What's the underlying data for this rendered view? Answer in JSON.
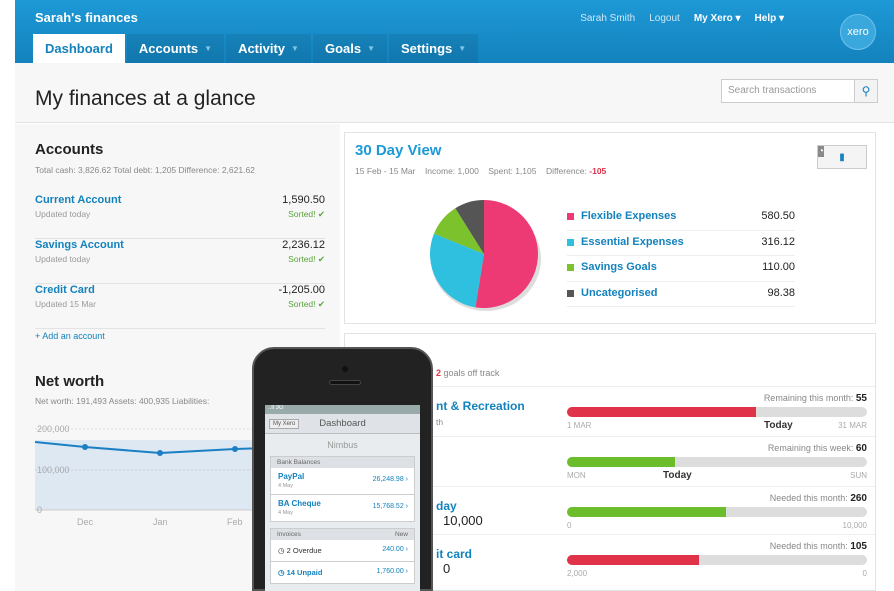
{
  "app": {
    "title": "Sarah's finances",
    "logo": "xero"
  },
  "toplinks": {
    "user": "Sarah Smith",
    "logout": "Logout",
    "myxero": "My Xero ▾",
    "help": "Help ▾"
  },
  "tabs": [
    {
      "label": "Dashboard",
      "active": true
    },
    {
      "label": "Accounts"
    },
    {
      "label": "Activity"
    },
    {
      "label": "Goals"
    },
    {
      "label": "Settings"
    }
  ],
  "page": {
    "title": "My finances at a glance",
    "search_placeholder": "Search transactions"
  },
  "accounts": {
    "title": "Accounts",
    "summary": "Total cash: 3,826.62   Total debt: 1,205   Difference: 2,621.62",
    "items": [
      {
        "name": "Current Account",
        "updated": "Updated today",
        "amount": "1,590.50",
        "status": "Sorted! ✔"
      },
      {
        "name": "Savings Account",
        "updated": "Updated today",
        "amount": "2,236.12",
        "status": "Sorted! ✔"
      },
      {
        "name": "Credit Card",
        "updated": "Updated 15 Mar",
        "amount": "-1,205.00",
        "status": "Sorted! ✔"
      }
    ],
    "add": "+ Add an account"
  },
  "networth": {
    "title": "Net worth",
    "summary": "Net worth: 191,493   Assets: 400,935   Liabilities:",
    "ticks_y": [
      "200,000",
      "100,000",
      "0"
    ],
    "ticks_x": [
      "Dec",
      "Jan",
      "Feb"
    ]
  },
  "thirty": {
    "title": "30 Day View",
    "range": "15 Feb - 15 Mar",
    "income": "Income: 1,000",
    "spent": "Spent: 1,105",
    "diff_label": "Difference:",
    "diff_value": "-105",
    "legend": [
      {
        "name": "Flexible Expenses",
        "value": "580.50",
        "color": "#ee3a74"
      },
      {
        "name": "Essential Expenses",
        "value": "316.12",
        "color": "#2fbfdf"
      },
      {
        "name": "Savings Goals",
        "value": "110.00",
        "color": "#7cc22c"
      },
      {
        "name": "Uncategorised",
        "value": "98.38",
        "color": "#555555"
      }
    ]
  },
  "goals": {
    "summary_red": "2",
    "summary_rest": "goals off track",
    "rows": [
      {
        "name": "nt & Recreation",
        "sub": "th",
        "amount": "",
        "rem_label": "Remaining this month:",
        "rem_value": "55",
        "fill": 0.63,
        "color": "#e0334a",
        "left_tick": "1 MAR",
        "right_tick": "31 MAR",
        "today": "Today"
      },
      {
        "name": "",
        "sub": "",
        "amount": "",
        "rem_label": "Remaining this week:",
        "rem_value": "60",
        "fill": 0.36,
        "color": "#6cbd2c",
        "left_tick": "MON",
        "right_tick": "SUN",
        "today": "Today"
      },
      {
        "name": "day",
        "sub": "",
        "amount": "10,000",
        "rem_label": "Needed this month:",
        "rem_value": "260",
        "fill": 0.53,
        "color": "#6cbd2c",
        "left_tick": "0",
        "right_tick": "10,000",
        "today": ""
      },
      {
        "name": "it card",
        "sub": "",
        "amount": "0",
        "rem_label": "Needed this month:",
        "rem_value": "105",
        "fill": 0.44,
        "color": "#e0334a",
        "left_tick": "2,000",
        "right_tick": "0",
        "today": ""
      }
    ]
  },
  "phone": {
    "carrier": "..ll 3G",
    "nav_back": "My Xero",
    "nav_title": "Dashboard",
    "org": "Nimbus",
    "bank_header": "Bank Balances",
    "banks": [
      {
        "name": "PayPal",
        "date": "4 May",
        "value": "26,248.98 ›"
      },
      {
        "name": "BA Cheque",
        "date": "4 May",
        "value": "15,768.52 ›"
      }
    ],
    "inv_header": "Invoices",
    "inv_new": "New",
    "invoices": [
      {
        "label": "◷ 2 Overdue",
        "value": "240.00 ›",
        "blue": false
      },
      {
        "label": "◷ 14 Unpaid",
        "value": "1,760.00 ›",
        "blue": true
      }
    ]
  }
}
